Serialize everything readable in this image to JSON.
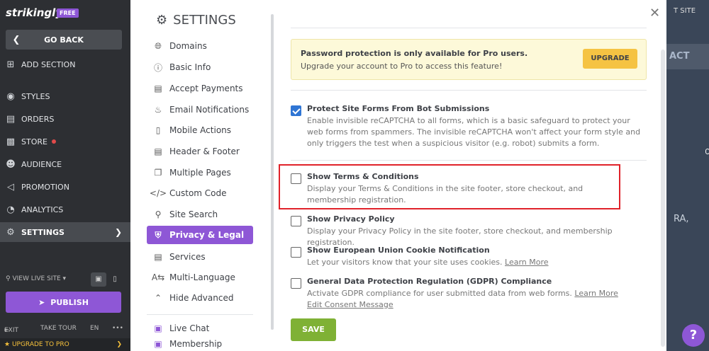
{
  "editor": {
    "logo": "strikingly",
    "plan_badge": "FREE",
    "go_back": "GO BACK",
    "nav": [
      {
        "label": "ADD SECTION",
        "icon": "plus-square-icon"
      },
      {
        "label": "STYLES",
        "icon": "palette-icon"
      },
      {
        "label": "ORDERS",
        "icon": "orders-icon"
      },
      {
        "label": "STORE",
        "icon": "store-icon"
      },
      {
        "label": "AUDIENCE",
        "icon": "audience-icon"
      },
      {
        "label": "PROMOTION",
        "icon": "megaphone-icon"
      },
      {
        "label": "ANALYTICS",
        "icon": "analytics-icon"
      },
      {
        "label": "SETTINGS",
        "icon": "gear-icon"
      }
    ],
    "view_live_site": "VIEW LIVE SITE",
    "publish": "PUBLISH",
    "exit": "EXIT",
    "take_tour": "TAKE TOUR",
    "language": "EN",
    "more": "•••",
    "upgrade_to_pro": "UPGRADE TO PRO"
  },
  "background_site": {
    "visit_site": "T SITE",
    "contact": "ACT",
    "fragment": "RA,"
  },
  "settings": {
    "title": "SETTINGS",
    "menu": [
      {
        "label": "Domains",
        "icon": "globe-icon"
      },
      {
        "label": "Basic Info",
        "icon": "info-icon"
      },
      {
        "label": "Accept Payments",
        "icon": "credit-card-icon"
      },
      {
        "label": "Email Notifications",
        "icon": "bell-icon"
      },
      {
        "label": "Mobile Actions",
        "icon": "mobile-icon"
      },
      {
        "label": "Header & Footer",
        "icon": "layout-icon"
      },
      {
        "label": "Multiple Pages",
        "icon": "pages-icon"
      },
      {
        "label": "Custom Code",
        "icon": "code-icon"
      },
      {
        "label": "Site Search",
        "icon": "search-icon"
      },
      {
        "label": "Privacy & Legal",
        "icon": "shield-icon"
      },
      {
        "label": "Services",
        "icon": "services-icon"
      },
      {
        "label": "Multi-Language",
        "icon": "translate-icon"
      },
      {
        "label": "Hide Advanced",
        "icon": "chevron-up-icon"
      },
      {
        "label": "Live Chat",
        "icon": "chat-icon"
      },
      {
        "label": "Membership",
        "icon": "membership-icon"
      }
    ],
    "active_item": "Privacy & Legal"
  },
  "privacy": {
    "pro_notice": {
      "title": "Password protection is only available for Pro users.",
      "subtitle": "Upgrade your account to Pro to access this feature!",
      "button": "UPGRADE"
    },
    "options": [
      {
        "title": "Protect Site Forms From Bot Submissions",
        "description": "Enable invisible reCAPTCHA to all forms, which is a basic safeguard to protect your web forms from spammers. The invisible reCAPTCHA won't affect your form style and only triggers the test when a suspicious visitor (e.g. robot) submits a form.",
        "checked": true
      },
      {
        "title": "Show Terms & Conditions",
        "description": "Display your Terms & Conditions in the site footer, store checkout, and membership registration.",
        "checked": false
      },
      {
        "title": "Show Privacy Policy",
        "description": "Display your Privacy Policy in the site footer, store checkout, and membership registration.",
        "checked": false
      },
      {
        "title": "Show European Union Cookie Notification",
        "description": "Let your visitors know that your site uses cookies.",
        "link": "Learn More",
        "checked": false
      },
      {
        "title": "General Data Protection Regulation (GDPR) Compliance",
        "description": "Activate GDPR compliance for user submitted data from web forms.",
        "link": "Learn More",
        "link2": "Edit Consent Message",
        "checked": false
      }
    ],
    "save": "SAVE"
  },
  "help": "?"
}
